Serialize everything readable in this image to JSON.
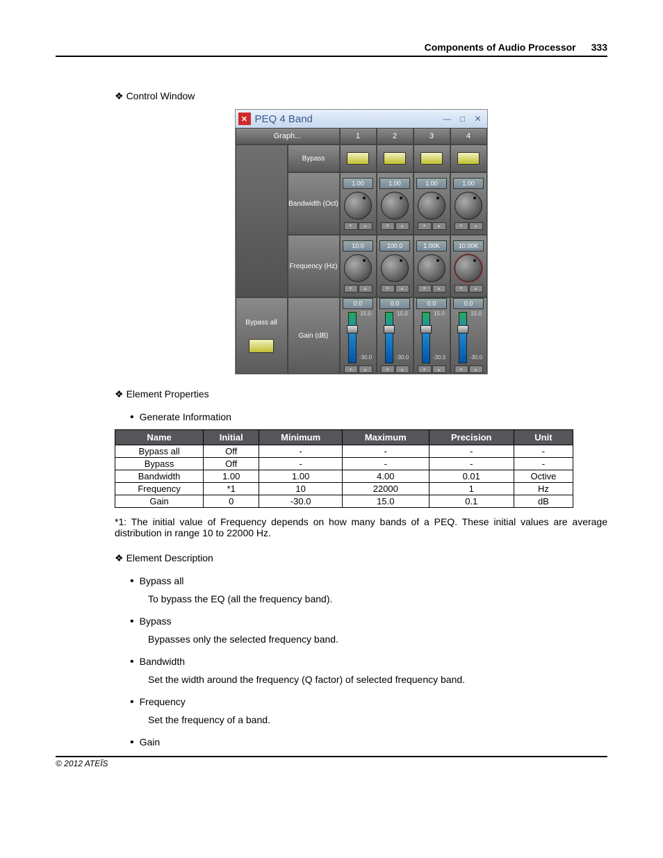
{
  "header": {
    "title": "Components of Audio Processor",
    "page": "333"
  },
  "footer": "© 2012 ATEÏS",
  "section1": "Control Window",
  "control_window": {
    "title": "PEQ 4 Band",
    "graph": "Graph...",
    "cols": [
      "1",
      "2",
      "3",
      "4"
    ],
    "rows": {
      "bypass": "Bypass",
      "bandwidth": "Bandwidth (Oct)",
      "frequency": "Frequency (Hz)",
      "bypass_all": "Bypass all",
      "gain": "Gain (dB)"
    },
    "bandwidth_vals": [
      "1.00",
      "1.00",
      "1.00",
      "1.00"
    ],
    "frequency_vals": [
      "10.0",
      "100.0",
      "1.00K",
      "10.00K"
    ],
    "gain_vals": [
      "0.0",
      "0.0",
      "0.0",
      "0.0"
    ],
    "gain_max": "15.0",
    "gain_min": "-30.0"
  },
  "section2": "Element Properties",
  "gen_info": "Generate Information",
  "table": {
    "headers": [
      "Name",
      "Initial",
      "Minimum",
      "Maximum",
      "Precision",
      "Unit"
    ],
    "rows": [
      [
        "Bypass all",
        "Off",
        "-",
        "-",
        "-",
        "-"
      ],
      [
        "Bypass",
        "Off",
        "-",
        "-",
        "-",
        "-"
      ],
      [
        "Bandwidth",
        "1.00",
        "1.00",
        "4.00",
        "0.01",
        "Octive"
      ],
      [
        "Frequency",
        "*1",
        "10",
        "22000",
        "1",
        "Hz"
      ],
      [
        "Gain",
        "0",
        "-30.0",
        "15.0",
        "0.1",
        "dB"
      ]
    ]
  },
  "note": "*1: The initial value of Frequency depends on how many bands of a PEQ. These initial values are average distribution in range 10 to 22000 Hz.",
  "section3": "Element Description",
  "descriptions": [
    {
      "title": "Bypass all",
      "text": "To bypass the EQ (all the frequency band)."
    },
    {
      "title": "Bypass",
      "text": "Bypasses only the selected frequency band."
    },
    {
      "title": "Bandwidth",
      "text": "Set the width around the frequency (Q factor) of selected frequency band."
    },
    {
      "title": "Frequency",
      "text": "Set the frequency of a band."
    },
    {
      "title": "Gain",
      "text": ""
    }
  ]
}
